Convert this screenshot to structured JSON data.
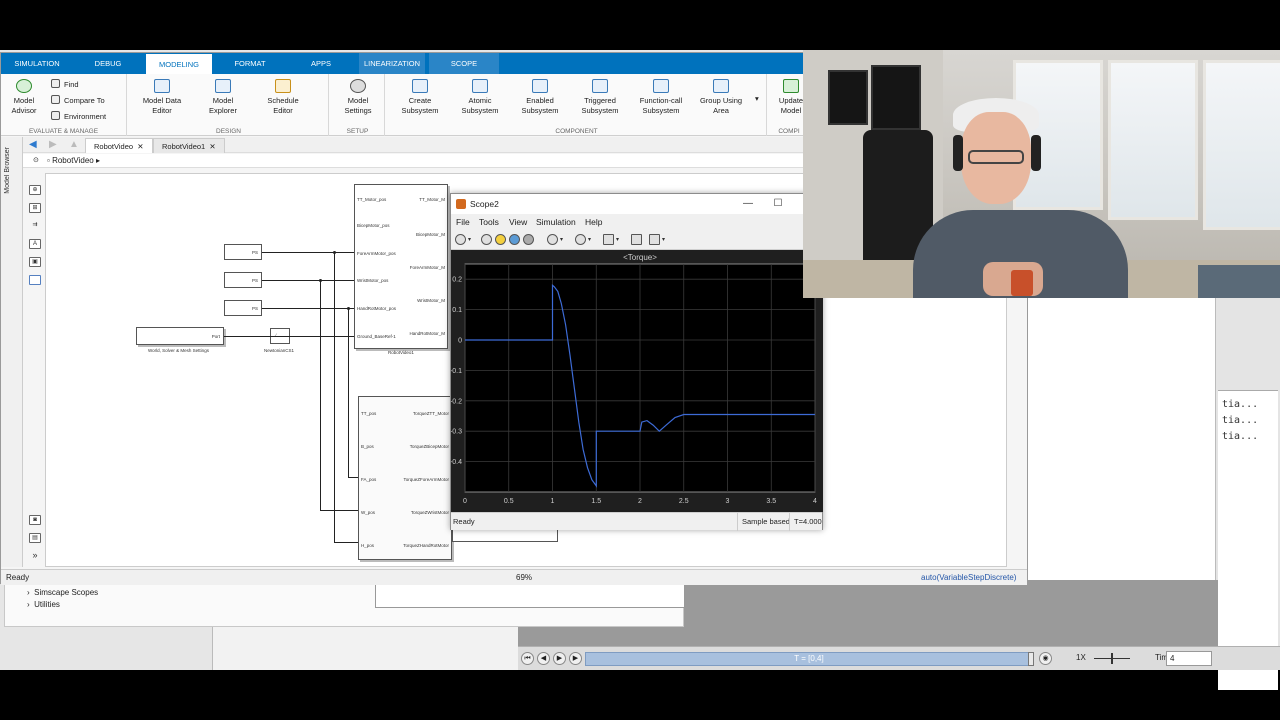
{
  "ribbon_tabs": [
    "SIMULATION",
    "DEBUG",
    "MODELING",
    "FORMAT",
    "APPS",
    "LINEARIZATION",
    "SCOPE"
  ],
  "ribbon": {
    "model_advisor": "Model\nAdvisor",
    "find": "Find",
    "compare_to": "Compare To",
    "environment": "Environment",
    "evaluate_manage": "EVALUATE & MANAGE",
    "model_data_editor": "Model Data\nEditor",
    "model_explorer": "Model\nExplorer",
    "schedule_editor": "Schedule\nEditor",
    "design": "DESIGN",
    "model_settings": "Model\nSettings",
    "setup": "SETUP",
    "create_subsystem": "Create\nSubsystem",
    "atomic_subsystem": "Atomic\nSubsystem",
    "enabled_subsystem": "Enabled\nSubsystem",
    "triggered_subsystem": "Triggered\nSubsystem",
    "function_call_subsystem": "Function-call\nSubsystem",
    "group_using_area": "Group Using\nArea",
    "component": "COMPONENT",
    "update_model": "Update\nModel",
    "compile": "COMPI"
  },
  "doc_tabs": [
    "RobotVideo",
    "RobotVideo1"
  ],
  "address": "RobotVideo",
  "model_browser": "Model Browser",
  "status": {
    "left": "Ready",
    "zoom": "69%",
    "solver": "auto(VariableStepDiscrete)"
  },
  "diagram": {
    "robot_block_name": "RobotVideo1",
    "robot_ports_in": [
      "TT_Motor_pos",
      "BicepMotor_pos",
      "ForeArmMotor_pos",
      "WristMotor_pos",
      "HandRotMotor_pos",
      "Ground_BaseRef-1"
    ],
    "robot_ports_out": [
      "TT_Motor_M",
      "BicepMotor_M",
      "ForeArmMotor_M",
      "WristMotor_M",
      "HandRotMotor_M"
    ],
    "ps_label": "PS",
    "solver_block_port": "Port",
    "solver_block_caption": "World, Solver & Mesh Settings",
    "newtonian_caption": "NewtonianCS1",
    "torque_ports_in": [
      "TT_pos",
      "B_pos",
      "FA_pos",
      "W_pos",
      "H_pos"
    ],
    "torque_ports_out": [
      "TorqueZTT_Motor",
      "TorqueZBicepMotor",
      "TorqueZForeArmMotor",
      "TorqueZWristMotor",
      "TorqueZHandRotMotor"
    ]
  },
  "scope": {
    "title": "Scope2",
    "menu": [
      "File",
      "Tools",
      "View",
      "Simulation",
      "Help"
    ],
    "plot_title": "<Torque>",
    "status_ready": "Ready",
    "status_sample": "Sample based",
    "status_time": "T=4.000"
  },
  "chart_data": {
    "type": "line",
    "title": "<Torque>",
    "xlabel": "",
    "ylabel": "",
    "xlim": [
      0,
      4
    ],
    "ylim": [
      -0.5,
      0.25
    ],
    "xticks": [
      "0",
      "0.5",
      "1",
      "1.5",
      "2",
      "2.5",
      "3",
      "3.5",
      "4"
    ],
    "yticks": [
      "0.2",
      "0.1",
      "0",
      "-0.1",
      "-0.2",
      "-0.3",
      "-0.4"
    ],
    "grid": true,
    "line_color": "#3d6bd6",
    "series": [
      {
        "x": [
          0,
          1.0,
          1.0,
          1.02,
          1.06,
          1.1,
          1.15,
          1.2,
          1.25,
          1.3,
          1.35,
          1.4,
          1.45,
          1.5,
          1.5,
          2.0,
          2.02,
          2.08,
          2.15,
          2.22,
          2.3,
          2.4,
          2.5,
          4.0
        ],
        "y": [
          0,
          0,
          0.18,
          0.175,
          0.16,
          0.12,
          0.05,
          -0.05,
          -0.16,
          -0.27,
          -0.36,
          -0.42,
          -0.46,
          -0.48,
          -0.3,
          -0.3,
          -0.27,
          -0.265,
          -0.28,
          -0.3,
          -0.28,
          -0.255,
          -0.245,
          -0.245
        ]
      }
    ]
  },
  "library": {
    "item1": "Simscape Scopes",
    "item2": "Utilities"
  },
  "right_code": [
    "tia...",
    "tia...",
    "tia..."
  ],
  "player": {
    "track": "T = [0,4]",
    "speed": "1X",
    "time_label": "Time",
    "time_value": "4"
  }
}
